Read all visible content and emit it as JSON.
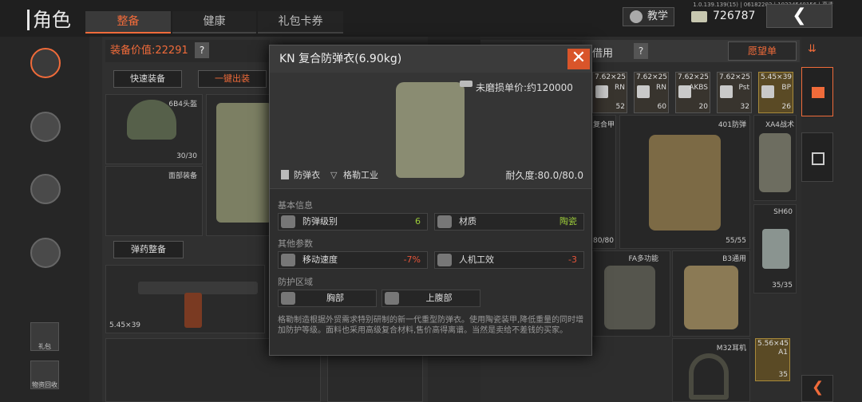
{
  "header": {
    "title": "角色",
    "tabs": [
      "整备",
      "健康",
      "礼包卡券"
    ],
    "version": "1.0.139.139(15) | 06182202 | 10234540156 | 高清",
    "teach": "教学",
    "currency": "726787",
    "back": "❮"
  },
  "equip": {
    "value_label": "装备价值:22291",
    "help": "?",
    "quick": "快速装备",
    "onekey": "一键出装",
    "helmet_name": "6B4头盔",
    "helmet_dur": "30/30",
    "face": "面部装备",
    "ammo_btn": "弹药整备",
    "gun_cal": "5.45×39"
  },
  "side": {
    "gift": "礼包",
    "recycle": "物资回收"
  },
  "right": {
    "borrow": "借用",
    "help": "?",
    "wishlist": "愿望单",
    "ammo": [
      {
        "cal": "7.62×25",
        "code": "RN",
        "n": "52"
      },
      {
        "cal": "7.62×25",
        "code": "RN",
        "n": "60"
      },
      {
        "cal": "7.62×25",
        "code": "AKBS",
        "n": "20"
      },
      {
        "cal": "7.62×25",
        "code": "Pst",
        "n": "32"
      },
      {
        "cal": "5.45×39",
        "code": "BP",
        "n": "26"
      }
    ],
    "items": {
      "vest_label": "复合甲",
      "vest401": "401防弹",
      "xa4": "XA4战术",
      "dur1": "80/80",
      "dur2": "55/55",
      "sh60": "SH60",
      "sh60_n": "35/35",
      "fa": "FA多功能",
      "b3": "B3通用",
      "m32": "M32耳机",
      "ammo556": "5.56×45",
      "ammo556_code": "A1",
      "ammo556_n": "35"
    }
  },
  "modal": {
    "title": "KN 复合防弹衣(6.90kg)",
    "close": "✕",
    "price": "未磨损单价:约120000",
    "type": "防弹衣",
    "brand": "格勒工业",
    "durability": "耐久度:80.0/80.0",
    "basic": "基本信息",
    "armor_level": "防弹级别",
    "armor_level_val": "6",
    "material": "材质",
    "material_val": "陶瓷",
    "other": "其他参数",
    "speed": "移动速度",
    "speed_val": "-7%",
    "ergo": "人机工效",
    "ergo_val": "-3",
    "zone": "防护区域",
    "chest": "胸部",
    "abdomen": "上腹部",
    "desc": "格勒制造根据外贸需求特别研制的新一代重型防弹衣。使用陶瓷装甲,降低重量的同时增加防护等级。面料也采用高级复合材料,售价高得离谱。当然是卖给不差钱的买家。"
  },
  "colors": {
    "accent": "#f06b3a",
    "good": "#9ccc3a",
    "bad": "#e8553a"
  }
}
